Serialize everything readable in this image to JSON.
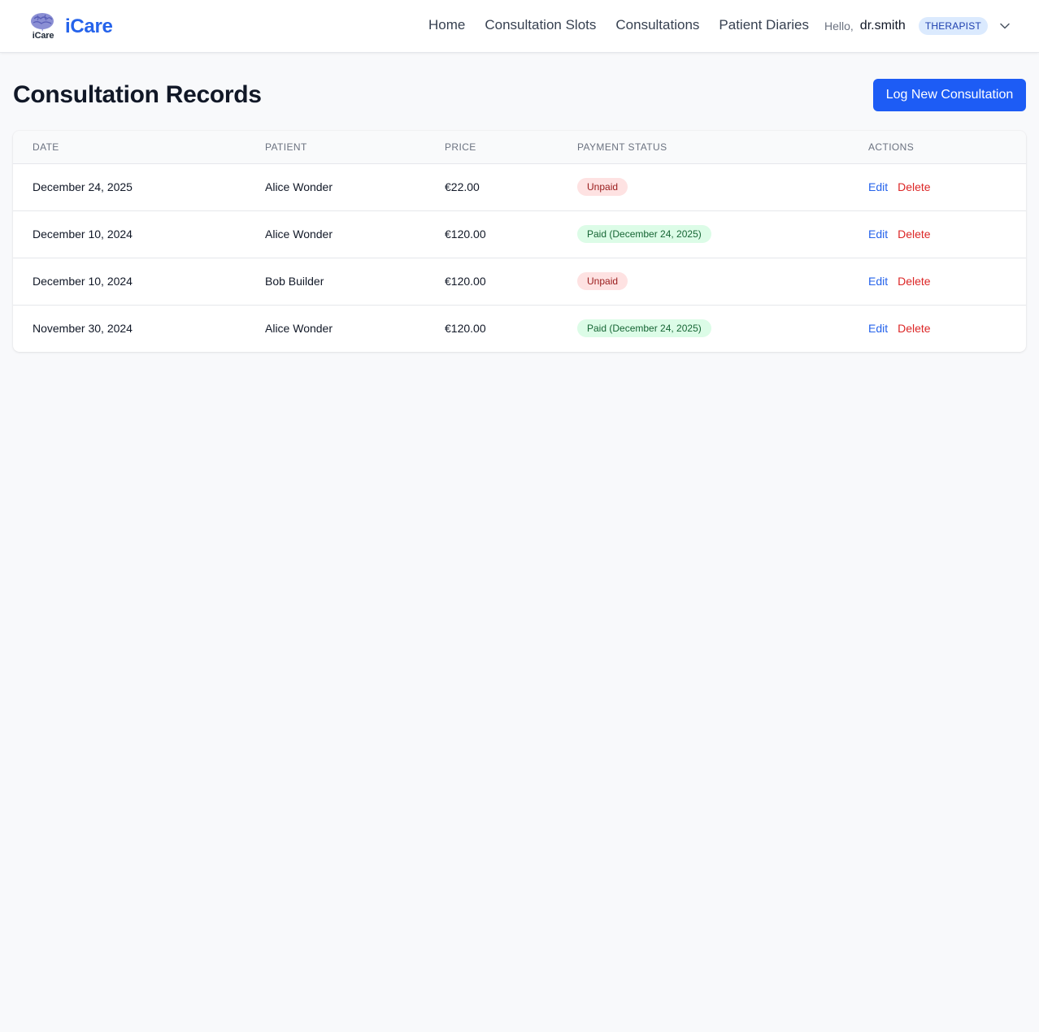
{
  "header": {
    "logo_text": "iCare",
    "brand_name": "iCare",
    "nav": [
      {
        "label": "Home"
      },
      {
        "label": "Consultation Slots"
      },
      {
        "label": "Consultations"
      },
      {
        "label": "Patient Diaries"
      }
    ],
    "greeting": "Hello,",
    "username": "dr.smith",
    "role": "THERAPIST",
    "menu_icon": "chevron-down-icon"
  },
  "page": {
    "title": "Consultation Records",
    "log_button_label": "Log New Consultation"
  },
  "table": {
    "columns": [
      "Date",
      "Patient",
      "Price",
      "Payment Status",
      "Actions"
    ],
    "rows": [
      {
        "date": "December 24, 2025",
        "patient": "Alice Wonder",
        "price": "€22.00",
        "status": "Unpaid",
        "status_type": "unpaid",
        "edit": "Edit",
        "delete": "Delete"
      },
      {
        "date": "December 10, 2024",
        "patient": "Alice Wonder",
        "price": "€120.00",
        "status": "Paid (December 24, 2025)",
        "status_type": "paid",
        "edit": "Edit",
        "delete": "Delete"
      },
      {
        "date": "December 10, 2024",
        "patient": "Bob Builder",
        "price": "€120.00",
        "status": "Unpaid",
        "status_type": "unpaid",
        "edit": "Edit",
        "delete": "Delete"
      },
      {
        "date": "November 30, 2024",
        "patient": "Alice Wonder",
        "price": "€120.00",
        "status": "Paid (December 24, 2025)",
        "status_type": "paid",
        "edit": "Edit",
        "delete": "Delete"
      }
    ]
  },
  "colors": {
    "brand": "#2563eb",
    "primary_button": "#1d5cf5",
    "unpaid_bg": "#fee2e2",
    "paid_bg": "#dcfce7",
    "delete": "#dc2626"
  }
}
